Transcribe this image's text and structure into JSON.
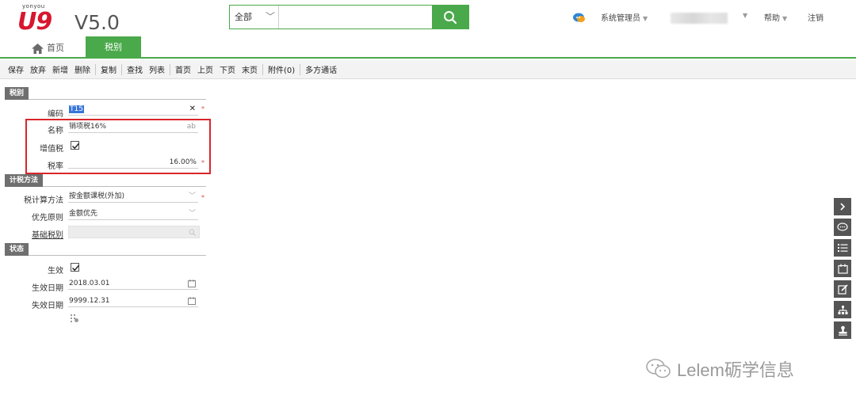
{
  "header": {
    "brand_small": "yonyou",
    "brand_logo": "U9",
    "brand_version": "V5.0",
    "search": {
      "scope": "全部",
      "placeholder": ""
    },
    "user_menu": "系统管理员",
    "help": "帮助",
    "logout": "注销"
  },
  "tabs": {
    "home": "首页",
    "active": "税别"
  },
  "toolbar": [
    "保存",
    "放弃",
    "新增",
    "删除",
    "复制",
    "查找",
    "列表",
    "首页",
    "上页",
    "下页",
    "末页",
    "附件(0)",
    "多方通话"
  ],
  "form": {
    "sections": {
      "tax_type": "税别",
      "calc_method": "计税方法",
      "status": "状态"
    },
    "code": {
      "label": "编码",
      "value": "T15"
    },
    "name": {
      "label": "名称",
      "value": "销项税16%",
      "suffix": "ab"
    },
    "vat": {
      "label": "增值税",
      "checked": true
    },
    "rate": {
      "label": "税率",
      "value": "16.00%"
    },
    "calc_method": {
      "label": "税计算方法",
      "value": "按金额课税(外加)"
    },
    "priority": {
      "label": "优先原则",
      "value": "金额优先"
    },
    "base_tax": {
      "label": "基础税别",
      "value": ""
    },
    "effective": {
      "label": "生效",
      "checked": true
    },
    "effective_date": {
      "label": "生效日期",
      "value": "2018.03.01"
    },
    "expiry_date": {
      "label": "失效日期",
      "value": "9999.12.31"
    }
  },
  "dock_icons": [
    "chevron-right-icon",
    "comment-icon",
    "list-icon",
    "calendar-icon",
    "edit-icon",
    "hierarchy-icon",
    "stamp-icon"
  ],
  "watermark": "Lelem砺学信息",
  "colors": {
    "accent": "#4aa94a",
    "brand": "#d7172f",
    "required": "#d94a3d",
    "highlight": "#d8262b"
  }
}
